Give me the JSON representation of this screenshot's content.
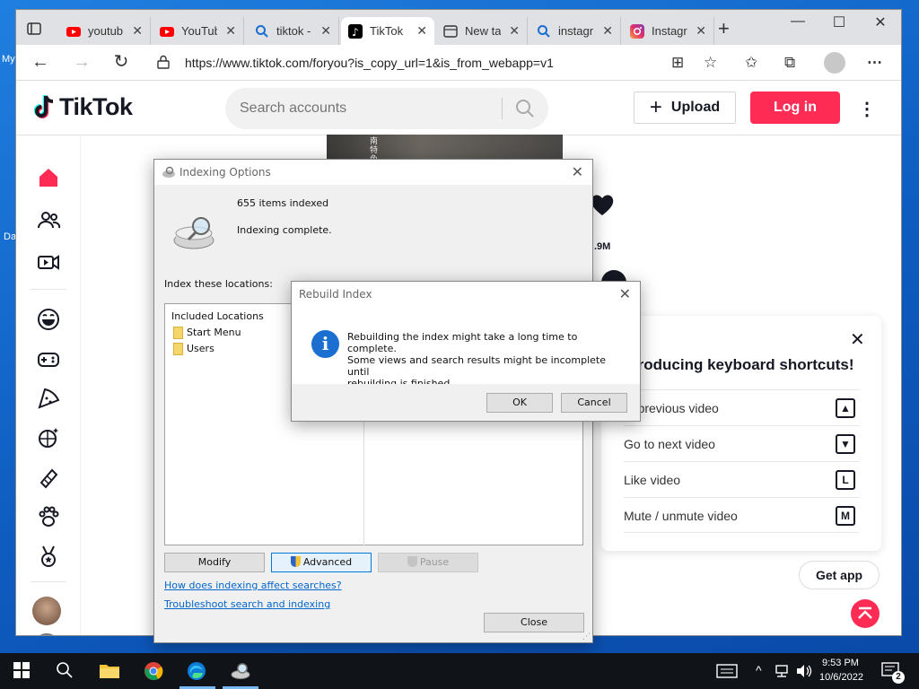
{
  "desktop": {
    "label_1": "My",
    "label_2": "Da"
  },
  "browser": {
    "tabs": [
      {
        "label": "youtub",
        "icon": "youtube-icon"
      },
      {
        "label": "YouTub",
        "icon": "youtube-icon"
      },
      {
        "label": "tiktok -",
        "icon": "search-icon"
      },
      {
        "label": "TikTok",
        "icon": "tiktok-icon"
      },
      {
        "label": "New ta",
        "icon": "new-tab-icon"
      },
      {
        "label": "instagr",
        "icon": "search-icon"
      },
      {
        "label": "Instagr",
        "icon": "instagram-icon"
      }
    ],
    "tab_close": "✕",
    "new_tab": "+",
    "url": "https://www.tiktok.com/foryou?is_copy_url=1&is_from_webapp=v1"
  },
  "tiktok": {
    "logo": "TikTok",
    "search_placeholder": "Search accounts",
    "upload_label": "Upload",
    "login_label": "Log in",
    "like_count": ".9M",
    "video_caption": "南特色",
    "shortcuts": {
      "title": "troducing keyboard shortcuts!",
      "rows": [
        {
          "label": "to previous video",
          "key": "▲"
        },
        {
          "label": "Go to next video",
          "key": "▼"
        },
        {
          "label": "Like video",
          "key": "L"
        },
        {
          "label": "Mute / unmute video",
          "key": "M"
        }
      ]
    },
    "get_app": "Get app"
  },
  "indexing": {
    "title": "Indexing Options",
    "items_indexed": "655 items indexed",
    "status": "Indexing complete.",
    "locations_label": "Index these locations:",
    "included_header": "Included Locations",
    "locations": [
      "Start Menu",
      "Users"
    ],
    "modify": "Modify",
    "advanced": "Advanced",
    "pause": "Pause",
    "link1": "How does indexing affect searches?",
    "link2": "Troubleshoot search and indexing",
    "close": "Close"
  },
  "rebuild": {
    "title": "Rebuild Index",
    "message_1": "Rebuilding the index might take a long time to complete.",
    "message_2": "Some views and search results might be incomplete until",
    "message_3": "rebuilding is finished.",
    "ok": "OK",
    "cancel": "Cancel"
  },
  "taskbar": {
    "time": "9:53 PM",
    "date": "10/6/2022",
    "notifications": "2"
  },
  "colors": {
    "tiktok_red": "#fe2c55",
    "windows_blue": "#1a6fd1"
  }
}
